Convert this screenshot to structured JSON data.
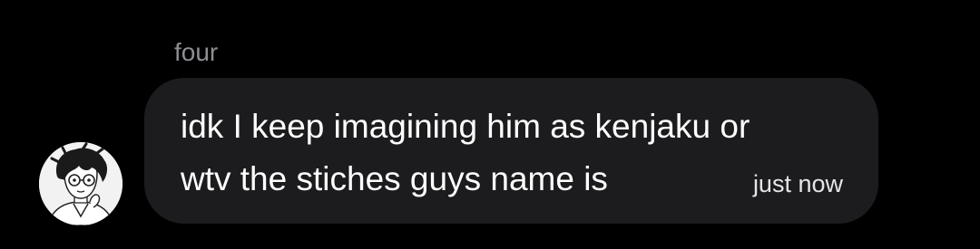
{
  "message": {
    "sender_name": "four",
    "avatar_icon": "manga-portrait-avatar",
    "text_lines": [
      "idk I keep imagining him as kenjaku or",
      "wtv the stiches guys name is"
    ],
    "timestamp": "just now"
  },
  "colors": {
    "background": "#000000",
    "bubble": "#1c1c1e",
    "text": "#ffffff",
    "sender_name": "#8e8e93"
  }
}
